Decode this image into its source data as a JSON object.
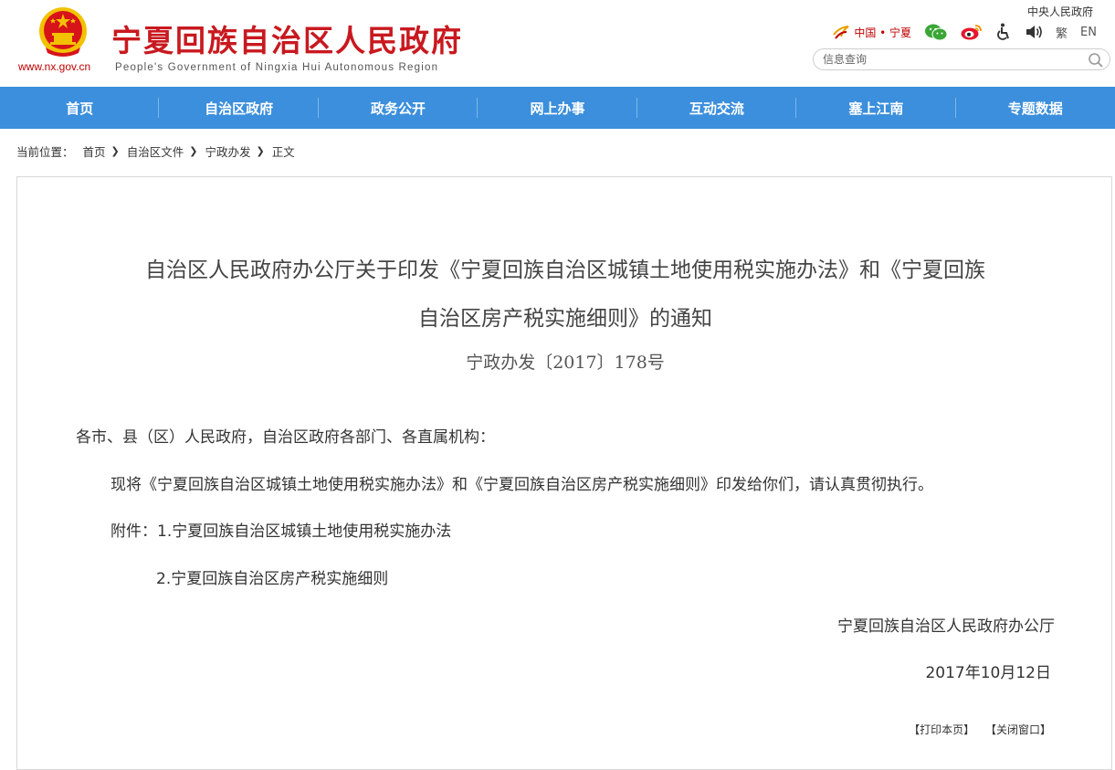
{
  "header": {
    "site_url": "www.nx.gov.cn",
    "site_title": "宁夏回族自治区人民政府",
    "site_subtitle": "People's Government of Ningxia Hui Autonomous Region",
    "central_link": "中央人民政府",
    "china_link": "中国 • 宁夏",
    "traditional": "繁",
    "english": "EN",
    "search_placeholder": "信息查询"
  },
  "nav": {
    "items": [
      "首页",
      "自治区政府",
      "政务公开",
      "网上办事",
      "互动交流",
      "塞上江南",
      "专题数据"
    ]
  },
  "breadcrumb": {
    "prefix": "当前位置：",
    "items": [
      "首页",
      "自治区文件",
      "宁政办发",
      "正文"
    ]
  },
  "article": {
    "title_line1": "自治区人民政府办公厅关于印发《宁夏回族自治区城镇土地使用税实施办法》和《宁夏回族",
    "title_line2": "自治区房产税实施细则》的通知",
    "doc_number": "宁政办发〔2017〕178号",
    "salutation": "各市、县（区）人民政府，自治区政府各部门、各直属机构：",
    "body": "现将《宁夏回族自治区城镇土地使用税实施办法》和《宁夏回族自治区房产税实施细则》印发给你们，请认真贯彻执行。",
    "attachment_1": "附件：1.宁夏回族自治区城镇土地使用税实施办法",
    "attachment_2": "2.宁夏回族自治区房产税实施细则",
    "signature": "宁夏回族自治区人民政府办公厅",
    "date": "2017年10月12日",
    "print_label": "【打印本页】",
    "close_label": "【关闭窗口】"
  },
  "colors": {
    "title_red": "#c8191f",
    "nav_blue": "#3b8fdc",
    "emblem_gold": "#f2c200",
    "emblem_red": "#d7141a"
  }
}
